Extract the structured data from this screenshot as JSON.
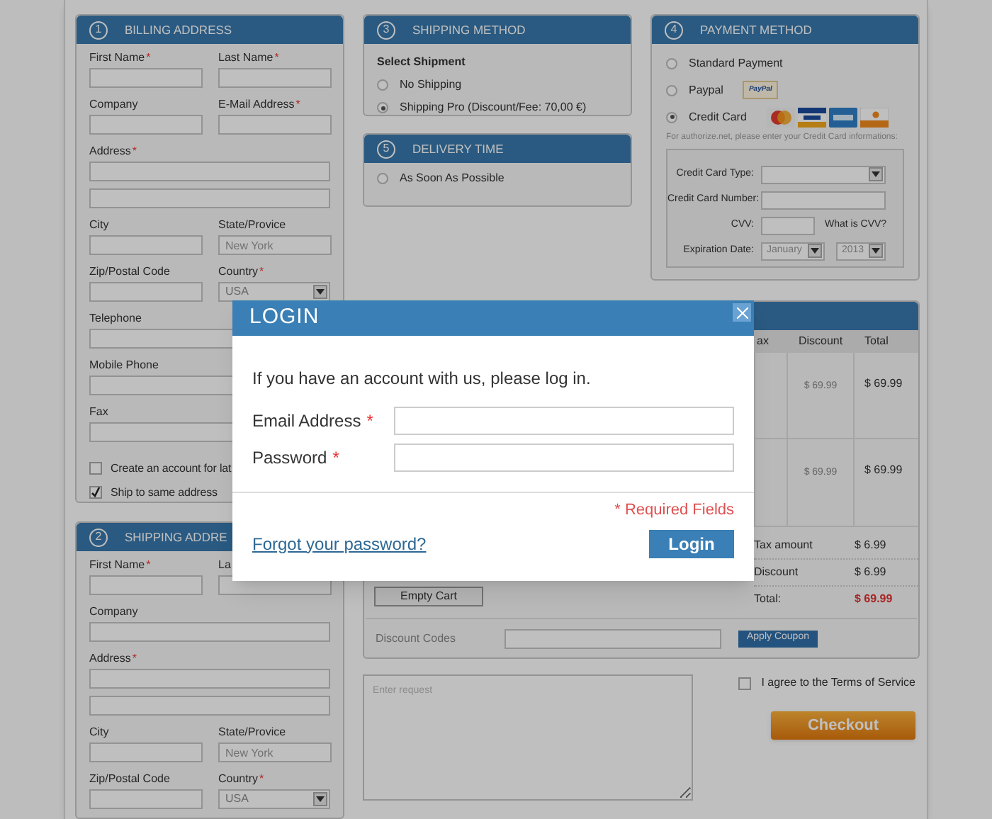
{
  "required_mark": "*",
  "billing_address": {
    "step": "1",
    "title": "BILLING ADDRESS",
    "rows": [
      [
        {
          "label": "First Name",
          "required": true,
          "kind": "text"
        },
        {
          "label": "Last Name",
          "required": true,
          "kind": "text"
        }
      ],
      [
        {
          "label": "Company",
          "required": false,
          "kind": "text"
        },
        {
          "label": "E-Mail Address",
          "required": true,
          "kind": "text"
        }
      ],
      [
        {
          "label": "Address",
          "required": true,
          "kind": "text"
        }
      ],
      [
        {
          "kind": "text"
        }
      ],
      [
        {
          "label": "City",
          "required": false,
          "kind": "text"
        },
        {
          "label": "State/Provice",
          "required": false,
          "kind": "text",
          "placeholder": "New York"
        }
      ],
      [
        {
          "label": "Zip/Postal Code",
          "required": false,
          "kind": "text"
        },
        {
          "label": "Country",
          "required": true,
          "kind": "select",
          "value": "USA"
        }
      ],
      [
        {
          "label": "Telephone",
          "required": false,
          "kind": "text"
        }
      ],
      [
        {
          "label": "Mobile Phone",
          "required": false,
          "kind": "text"
        }
      ],
      [
        {
          "label": "Fax",
          "required": false,
          "kind": "text"
        }
      ]
    ],
    "checkboxes": [
      {
        "label": "Create an account for lat",
        "checked": false
      },
      {
        "label": "Ship to same address",
        "checked": true
      }
    ]
  },
  "shipping_address": {
    "step": "2",
    "title": "SHIPPING ADDRE",
    "rows": [
      [
        {
          "label": "First Name",
          "required": true,
          "kind": "text"
        },
        {
          "label": "La",
          "required": false,
          "kind": "text"
        }
      ],
      [
        {
          "label": "Company",
          "required": false,
          "kind": "text"
        }
      ],
      [
        {
          "label": "Address",
          "required": true,
          "kind": "text"
        }
      ],
      [
        {
          "kind": "text"
        }
      ],
      [
        {
          "label": "City",
          "required": false,
          "kind": "text"
        },
        {
          "label": "State/Provice",
          "required": false,
          "kind": "text",
          "placeholder": "New York"
        }
      ],
      [
        {
          "label": "Zip/Postal Code",
          "required": false,
          "kind": "text"
        },
        {
          "label": "Country",
          "required": true,
          "kind": "select",
          "value": "USA"
        }
      ]
    ]
  },
  "shipping_method": {
    "step": "3",
    "title": "SHIPPING METHOD",
    "subtitle": "Select Shipment",
    "options": [
      {
        "label": "No Shipping",
        "selected": false
      },
      {
        "label": "Shipping Pro (Discount/Fee: 70,00 €)",
        "selected": true
      }
    ]
  },
  "delivery_time": {
    "step": "5",
    "title": "DELIVERY TIME",
    "options": [
      {
        "label": "As Soon As Possible",
        "selected": false
      }
    ]
  },
  "payment_method": {
    "step": "4",
    "title": "PAYMENT METHOD",
    "options": [
      {
        "label": "Standard Payment",
        "selected": false,
        "kind": "plain"
      },
      {
        "label": "Paypal",
        "selected": false,
        "kind": "paypal",
        "badge": "PayPal"
      },
      {
        "label": "Credit Card",
        "selected": true,
        "kind": "cards"
      }
    ],
    "note": "For authorize.net, please enter your Credit Card informations:",
    "card_form": {
      "type_label": "Credit Card Type:",
      "number_label": "Credit Card Number:",
      "cvv_label": "CVV:",
      "cvv_link": "What is CVV?",
      "expiry_label": "Expiration Date:",
      "expiry_month": "January",
      "expiry_year": "2013"
    }
  },
  "order": {
    "columns": [
      "ax",
      "Discount",
      "Total"
    ],
    "rows": [
      {
        "discount": "$ 69.99",
        "total": "$ 69.99"
      },
      {
        "discount": "$ 69.99",
        "total": "$ 69.99"
      }
    ],
    "summary": [
      {
        "label": "Tax amount",
        "value": "$ 6.99",
        "kind": "plain"
      },
      {
        "label": "Discount",
        "value": "$ 6.99",
        "kind": "plain"
      },
      {
        "label": "Total:",
        "value": "$ 69.99",
        "kind": "grand"
      }
    ],
    "empty_cart": "Empty Cart",
    "discount_label": "Discount Codes",
    "apply_button": "Apply Coupon"
  },
  "request": {
    "placeholder": "Enter request"
  },
  "terms": {
    "label": "I agree to the Terms of Service",
    "checked": false
  },
  "checkout_button": "Checkout",
  "login_dialog": {
    "title": "LOGIN",
    "intro": "If you have an account with us, please log in.",
    "fields": [
      {
        "label": "Email Address",
        "required": true
      },
      {
        "label": "Password",
        "required": true
      }
    ],
    "required_note": "* Required Fields",
    "forgot_link": "Forgot your password?",
    "login_button": "Login"
  }
}
